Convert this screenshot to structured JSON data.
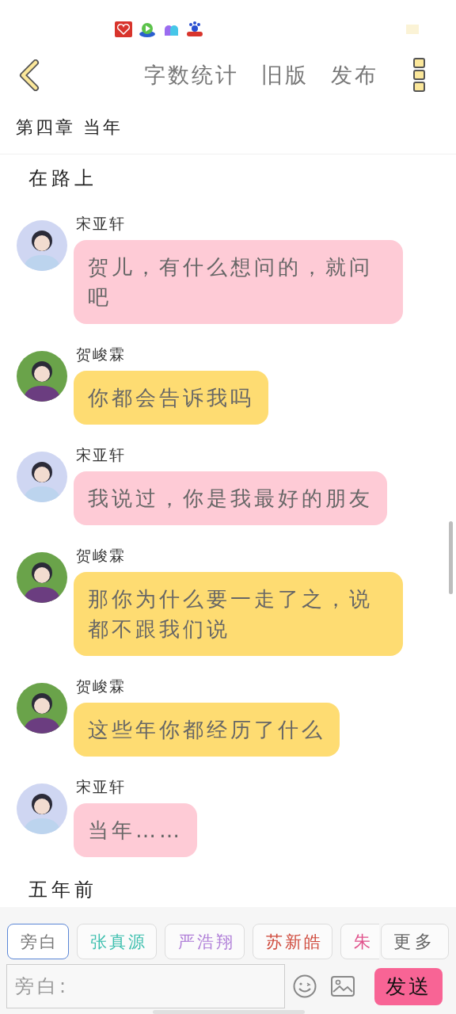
{
  "header": {
    "actions": [
      "字数统计",
      "旧版",
      "发布"
    ]
  },
  "chapter_title": "第四章 当年",
  "messages": [
    {
      "kind": "narration",
      "text": "在路上"
    },
    {
      "kind": "chat",
      "sender": "宋亚轩",
      "text": "贺儿，有什么想问的，就问吧",
      "color": "#fecbd6"
    },
    {
      "kind": "chat",
      "sender": "贺峻霖",
      "text": "你都会告诉我吗",
      "color": "#fedc72"
    },
    {
      "kind": "chat",
      "sender": "宋亚轩",
      "text": "我说过，你是我最好的朋友",
      "color": "#fecbd6"
    },
    {
      "kind": "chat",
      "sender": "贺峻霖",
      "text": "那你为什么要一走了之，说都不跟我们说",
      "color": "#fedc72"
    },
    {
      "kind": "chat",
      "sender": "贺峻霖",
      "text": "这些年你都经历了什么",
      "color": "#fedc72"
    },
    {
      "kind": "chat",
      "sender": "宋亚轩",
      "text": "当年……",
      "color": "#fecbd6"
    },
    {
      "kind": "narration",
      "text": "五年前"
    }
  ],
  "roles": [
    {
      "label": "旁白",
      "color": "#777777",
      "selected": true
    },
    {
      "label": "张真源",
      "color": "#3cbfae",
      "selected": false
    },
    {
      "label": "严浩翔",
      "color": "#b07fd8",
      "selected": false
    },
    {
      "label": "苏新皓",
      "color": "#cf4a3c",
      "selected": false
    },
    {
      "label": "朱",
      "color": "#e0508a",
      "selected": false
    }
  ],
  "more_button": "更多",
  "input": {
    "placeholder": "旁白:"
  },
  "send_button": "发送"
}
